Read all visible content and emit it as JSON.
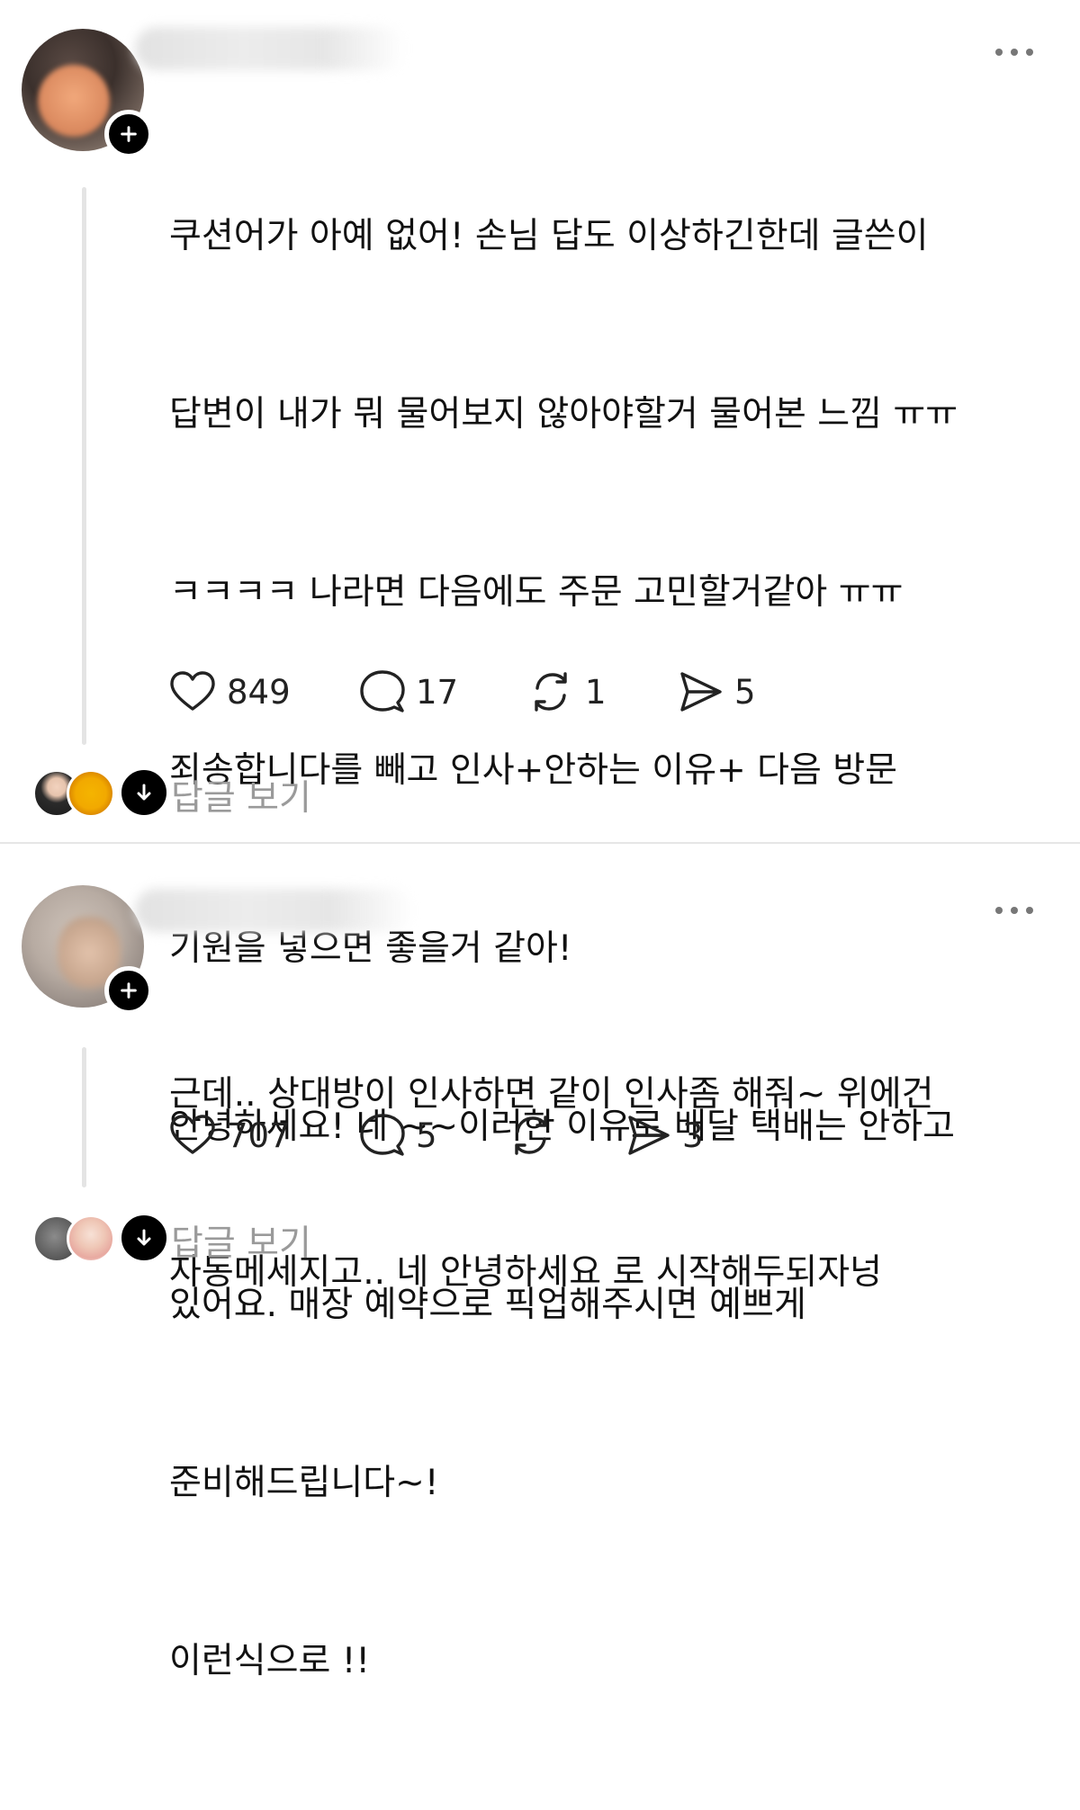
{
  "posts": [
    {
      "lines": [
        "쿠션어가 아예 없어! 손님 답도 이상하긴한데 글쓴이",
        "답변이 내가 뭐 물어보지 않아야할거 물어본 느낌 ㅠㅠ",
        "ㅋㅋㅋㅋ 나라면 다음에도 주문 고민할거같아 ㅠㅠ",
        "죄송합니다를 빼고 인사+안하는 이유+ 다음 방문",
        "기원을 넣으면 좋을거 같아!",
        "안녕하세요! 네 ~~이러한 이유로 배달 택배는 안하고",
        "있어요. 매장 예약으로 픽업해주시면 예쁘게",
        "준비해드립니다~!",
        "이런식으로 !!"
      ],
      "likes": "849",
      "comments": "17",
      "reposts": "1",
      "shares": "5",
      "view_replies": "답글 보기"
    },
    {
      "lines": [
        "근데.. 상대방이 인사하면 같이 인사좀 해줘~ 위에건",
        "자동메세지고.. 네 안녕하세요 로 시작해두되자넝"
      ],
      "likes": "707",
      "comments": "5",
      "reposts": "",
      "shares": "3",
      "view_replies": "답글 보기"
    }
  ],
  "icons": {
    "like": "heart-icon",
    "comment": "comment-bubble-icon",
    "repost": "repost-icon",
    "share": "send-icon",
    "more": "more-dots-icon",
    "follow": "plus-icon",
    "expand": "arrow-down-icon"
  }
}
